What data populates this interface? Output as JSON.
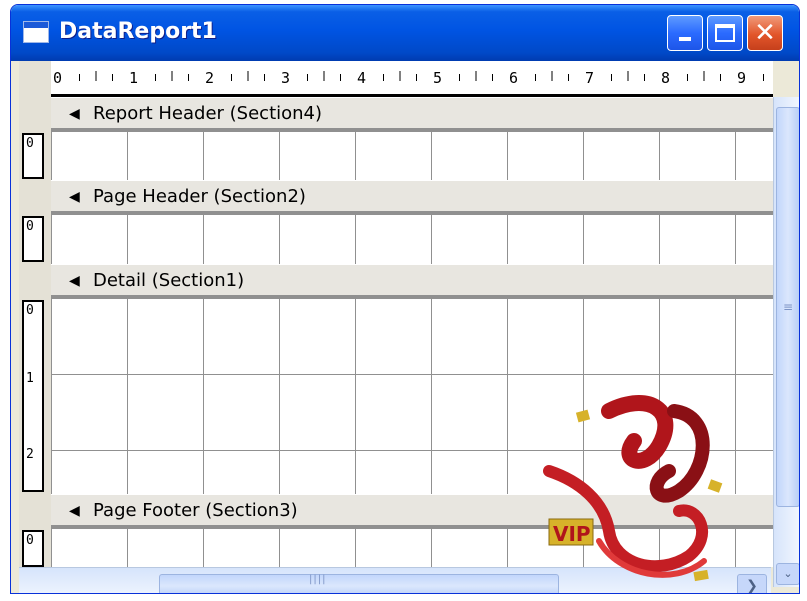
{
  "window": {
    "title": "DataReport1",
    "close_glyph": "✕"
  },
  "ruler": {
    "digits": [
      "0",
      "1",
      "2",
      "3",
      "4",
      "5",
      "6",
      "7",
      "8",
      "9"
    ]
  },
  "sections": [
    {
      "label": "Report Header (Section4)"
    },
    {
      "label": "Page Header (Section2)"
    },
    {
      "label": "Detail (Section1)"
    },
    {
      "label": "Page Footer (Section3)"
    }
  ],
  "vertical_rulers": {
    "report_header": "0",
    "page_header": "0",
    "detail": [
      "0",
      "1",
      "2"
    ],
    "page_footer": "0"
  },
  "watermark": {
    "text": "VIP"
  },
  "icons": {
    "band_arrow": "section-collapse-arrow-icon",
    "scroll_right": "chevron-right-icon",
    "scroll_down": "chevron-down-icon"
  },
  "glyphs": {
    "band_arrow": "◀",
    "scroll_right": "❯",
    "scroll_down": "⌄",
    "grip_v": "≡",
    "grip_h": "||||"
  },
  "colors": {
    "titlebar": "#0054e3",
    "band": "#e8e6e0",
    "grid": "#909090",
    "logo_red": "#b0151b",
    "logo_gold": "#d7b22a"
  }
}
